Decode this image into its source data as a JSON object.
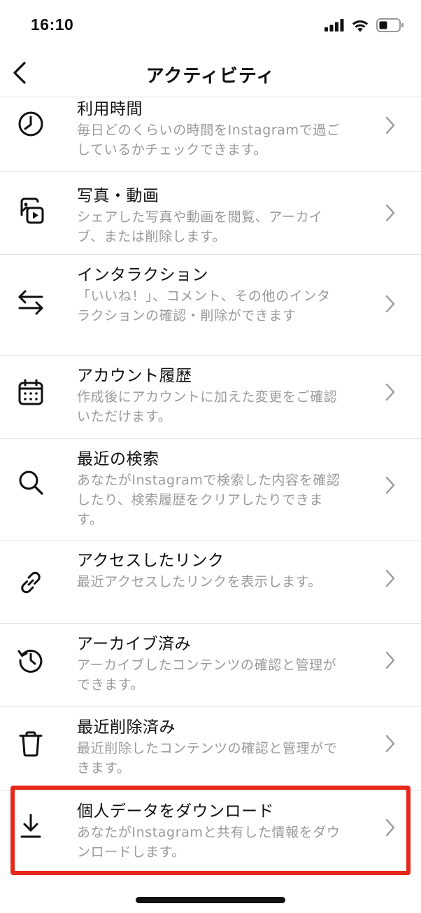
{
  "status_bar": {
    "time": "16:10",
    "icons": [
      "signal-icon",
      "wifi-icon",
      "battery-icon"
    ]
  },
  "nav": {
    "title": "アクティビティ",
    "back_icon": "chevron-left-icon"
  },
  "items": [
    {
      "icon": "clock-icon",
      "title": "利用時間",
      "desc": "毎日どのくらいの時間をInstagramで過ごしているかチェックできます。"
    },
    {
      "icon": "photo-video-icon",
      "title": "写真・動画",
      "desc": "シェアした写真や動画を閲覧、アーカイブ、または削除します。"
    },
    {
      "icon": "arrows-swap-icon",
      "title": "インタラクション",
      "desc": "「いいね！」、コメント、その他のインタラクションの確認・削除ができます"
    },
    {
      "icon": "calendar-icon",
      "title": "アカウント履歴",
      "desc": "作成後にアカウントに加えた変更をご確認いただけます。"
    },
    {
      "icon": "search-icon",
      "title": "最近の検索",
      "desc": "あなたがInstagramで検索した内容を確認したり、検索履歴をクリアしたりできます。"
    },
    {
      "icon": "link-icon",
      "title": "アクセスしたリンク",
      "desc": "最近アクセスしたリンクを表示します。"
    },
    {
      "icon": "archive-history-icon",
      "title": "アーカイブ済み",
      "desc": "アーカイブしたコンテンツの確認と管理ができます。"
    },
    {
      "icon": "trash-icon",
      "title": "最近削除済み",
      "desc": "最近削除したコンテンツの確認と管理ができます。"
    },
    {
      "icon": "download-icon",
      "title": "個人データをダウンロード",
      "desc": "あなたがInstagramと共有した情報をダウンロードします。",
      "highlighted": true
    }
  ],
  "colors": {
    "highlight": "#e6281a",
    "secondary_text": "#9a9a9a",
    "divider": "#e4e4e4"
  }
}
